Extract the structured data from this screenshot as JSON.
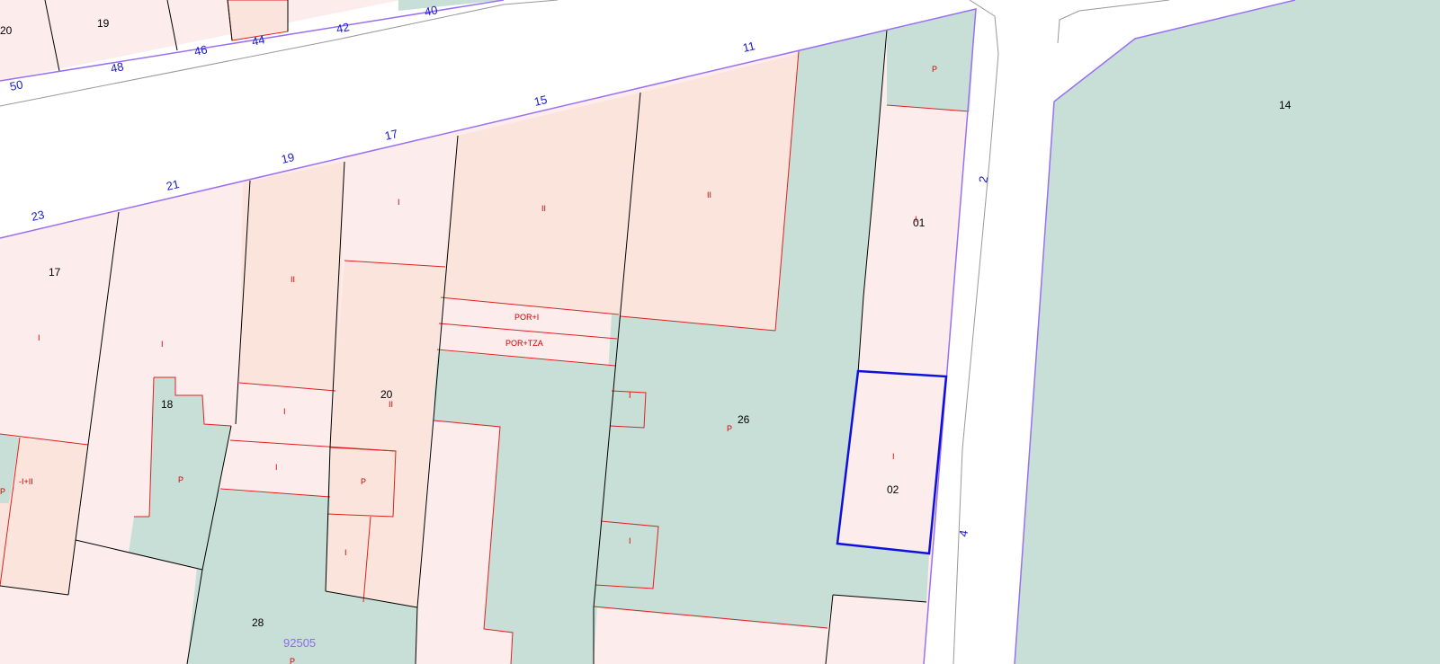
{
  "colors": {
    "background": "#ffffff",
    "road_fill": "#ffffff",
    "garden": "#c7dfd6",
    "built_light": "#fcecec",
    "built_medium": "#fbe4dc",
    "sub_parcel_line": "#e02020",
    "parcel_line": "#000000",
    "block_boundary": "#9a70f2",
    "selection": "#1010dd",
    "floor_label": "#cc0000",
    "house_number": "#1a1acc",
    "block_label": "#8a6cf0"
  },
  "house_numbers": {
    "n50": "50",
    "n48": "48",
    "n46": "46",
    "n44": "44",
    "n42": "42",
    "n40": "40",
    "n23": "23",
    "n21": "21",
    "n19": "19",
    "n17": "17",
    "n15": "15",
    "n11": "11",
    "n2": "2",
    "n4": "4"
  },
  "plots": {
    "p20_top": "20",
    "p19": "19",
    "p17": "17",
    "p18": "18",
    "p20": "20",
    "p26": "26",
    "p01": "01",
    "p02": "02",
    "p28": "28",
    "p14": "14"
  },
  "floors": {
    "I_a": "I",
    "I_b": "I",
    "I_c": "I",
    "I_d": "I",
    "I_e": "I",
    "I_f": "I",
    "I_g": "I",
    "I_h": "I",
    "I_i": "I",
    "I_j": "I",
    "II_a": "II",
    "II_b": "II",
    "II_c": "II",
    "II_d": "II",
    "P_a": "P",
    "P_b": "P",
    "P_c": "P",
    "P_d": "P",
    "P_e": "P",
    "P_f": "P",
    "por_i": "POR+I",
    "por_tza": "POR+TZA",
    "i_ii": "-I+II"
  },
  "block_id": "92505",
  "selected_parcel": "02"
}
